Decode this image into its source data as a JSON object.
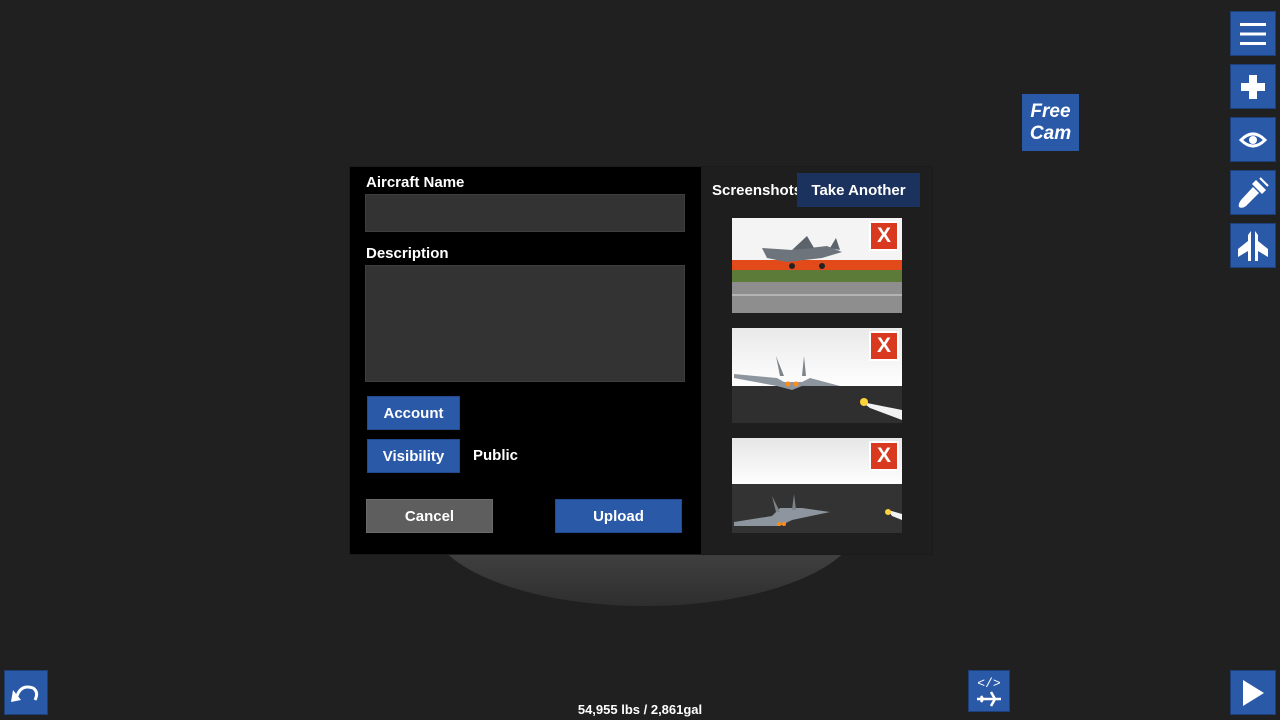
{
  "free_cam": {
    "line1": "Free",
    "line2": "Cam"
  },
  "dialog": {
    "aircraft_name_label": "Aircraft Name",
    "aircraft_name_value": "",
    "description_label": "Description",
    "description_value": "",
    "account_label": "Account",
    "visibility_label": "Visibility",
    "visibility_value": "Public",
    "cancel_label": "Cancel",
    "upload_label": "Upload",
    "screenshots_label": "Screenshots",
    "take_another_label": "Take Another",
    "screenshot_remove_label": "X"
  },
  "toolbar": {
    "icons": [
      "menu-icon",
      "add-part-icon",
      "view-icon",
      "paint-icon",
      "symmetry-icon"
    ]
  },
  "status": {
    "weight_fuel": "54,955 lbs / 2,861gal"
  },
  "colors": {
    "accent": "#2a59a8",
    "danger": "#d9391f",
    "panel": "#000000",
    "background": "#202020"
  }
}
